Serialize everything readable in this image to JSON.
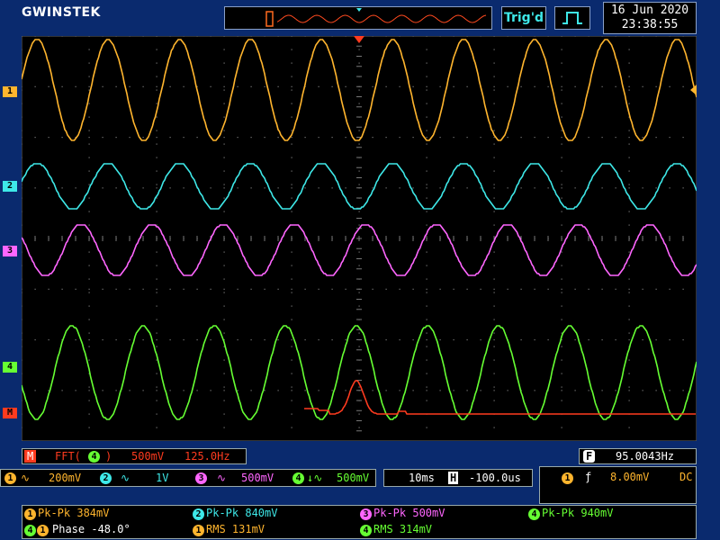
{
  "header": {
    "logo": "GWINSTEK",
    "trigger_status": "Trig'd",
    "date": "16 Jun 2020",
    "time": "23:38:55"
  },
  "channels": {
    "ch1": {
      "marker": "1",
      "color": "#ffb52e"
    },
    "ch2": {
      "marker": "2",
      "color": "#3ee8e8"
    },
    "ch3": {
      "marker": "3",
      "color": "#ff66ff"
    },
    "ch4": {
      "marker": "4",
      "color": "#66ff33"
    },
    "math": {
      "marker": "M",
      "color": "#ff3b1f"
    }
  },
  "math_readout": {
    "label": "M",
    "function": "FFT(",
    "source": "4",
    "close": ")",
    "scale": "500mV",
    "span": "125.0Hz"
  },
  "frequency_readout": {
    "label": "F",
    "value": "95.0043Hz"
  },
  "vertical_scales": [
    {
      "channel": "1",
      "coupling_icon": "ac-coupling-icon",
      "value": "200mV"
    },
    {
      "channel": "2",
      "coupling_icon": "ac-coupling-icon",
      "value": "1V"
    },
    {
      "channel": "3",
      "coupling_icon": "ac-coupling-icon",
      "value": "500mV"
    },
    {
      "channel": "4",
      "coupling_icon": "ac-coupling-icon",
      "value": "500mV"
    }
  ],
  "horizontal": {
    "timebase": "10ms",
    "position_label": "H",
    "position": "-100.0us"
  },
  "trigger": {
    "source": "1",
    "edge_icon": "rising-edge-icon",
    "level": "8.00mV",
    "coupling": "DC"
  },
  "measurements": [
    {
      "channel": "1",
      "text": "Pk-Pk 384mV"
    },
    {
      "channel": "2",
      "text": "Pk-Pk 840mV"
    },
    {
      "channel": "3",
      "text": "Pk-Pk 500mV"
    },
    {
      "channel": "4",
      "text": "Pk-Pk 940mV"
    },
    {
      "channel": "4",
      "channel_b": "1",
      "text": "Phase -48.0°"
    },
    {
      "channel": "1",
      "text": "RMS 131mV"
    },
    {
      "channel": "4",
      "text": "RMS 314mV"
    }
  ]
}
